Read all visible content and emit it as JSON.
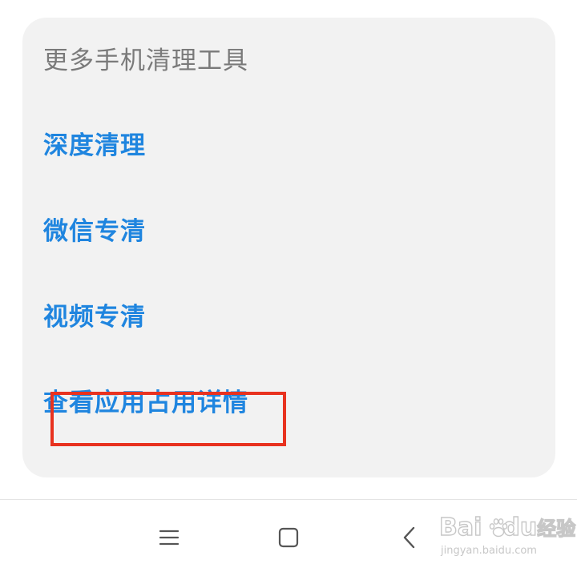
{
  "card": {
    "title": "更多手机清理工具",
    "tools": [
      {
        "label": "深度清理"
      },
      {
        "label": "微信专清"
      },
      {
        "label": "视频专清"
      },
      {
        "label": "查看应用占用详情"
      }
    ]
  },
  "nav_bar": {
    "menu_icon": "menu-icon",
    "home_icon": "square-home-icon",
    "back_icon": "back-chevron-icon"
  },
  "watermark": {
    "brand_left": "Bai",
    "brand_right": "du",
    "brand_cn": "经验",
    "url": "jingyan.baidu.com"
  },
  "colors": {
    "card_bg": "#f2f2f2",
    "title_gray": "#7a7a7a",
    "link_blue": "#1f85df",
    "highlight_red": "#e8321f",
    "nav_icon_gray": "#555555"
  }
}
